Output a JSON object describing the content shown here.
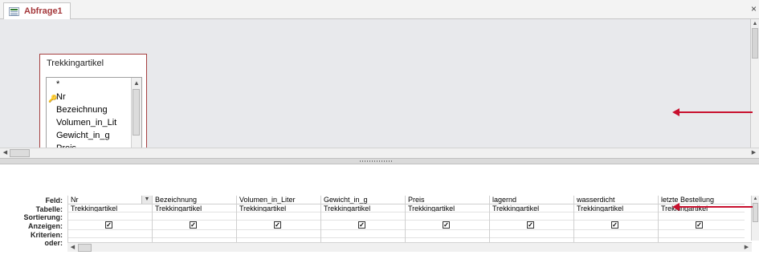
{
  "window": {
    "tab_title": "Abfrage1",
    "close_glyph": "×"
  },
  "field_list": {
    "title": "Trekkingartikel",
    "fields": [
      "*",
      "Nr",
      "Bezeichnung",
      "Volumen_in_Lit",
      "Gewicht_in_g",
      "Preis"
    ],
    "key_field_index": 1
  },
  "grid": {
    "row_labels": {
      "feld": "Feld:",
      "tabelle": "Tabelle:",
      "sortierung": "Sortierung:",
      "anzeigen": "Anzeigen:",
      "kriterien": "Kriterien:",
      "oder": "oder:"
    },
    "columns": [
      {
        "field": "Nr",
        "table": "Trekkingartikel",
        "show": true
      },
      {
        "field": "Bezeichnung",
        "table": "Trekkingartikel",
        "show": true
      },
      {
        "field": "Volumen_in_Liter",
        "table": "Trekkingartikel",
        "show": true
      },
      {
        "field": "Gewicht_in_g",
        "table": "Trekkingartikel",
        "show": true
      },
      {
        "field": "Preis",
        "table": "Trekkingartikel",
        "show": true
      },
      {
        "field": "lagernd",
        "table": "Trekkingartikel",
        "show": true
      },
      {
        "field": "wasserdicht",
        "table": "Trekkingartikel",
        "show": true
      },
      {
        "field": "letzte Bestellung",
        "table": "Trekkingartikel",
        "show": true
      }
    ]
  },
  "icons": {
    "query_icon": "query-icon",
    "key_icon": "primary-key-icon",
    "dropdown": "chevron-down-icon"
  },
  "colors": {
    "accent_tab": "#a4373a",
    "table_border": "#a54040",
    "annotation_arrow": "#c8102e"
  }
}
